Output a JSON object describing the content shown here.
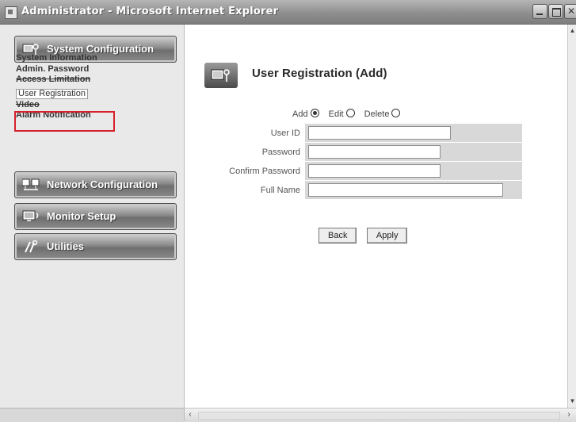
{
  "window": {
    "title": "Administrator - Microsoft Internet Explorer",
    "controls": [
      "minimize",
      "maximize",
      "close"
    ]
  },
  "sidebar": {
    "sections": [
      {
        "label": "System Configuration",
        "icon": "monitor-key-icon"
      },
      {
        "label": "Network Configuration",
        "icon": "network-computers-icon"
      },
      {
        "label": "Monitor Setup",
        "icon": "monitor-icon"
      },
      {
        "label": "Utilities",
        "icon": "tools-icon"
      }
    ],
    "submenu": [
      {
        "label": "System Information"
      },
      {
        "label": "Admin. Password"
      },
      {
        "label": "Access Limitation"
      },
      {
        "label": "User Registration",
        "current": true
      },
      {
        "label": "Video"
      },
      {
        "label": "Alarm Notification"
      }
    ]
  },
  "main": {
    "title": "User Registration (Add)",
    "modes": [
      {
        "label": "Add",
        "checked": true
      },
      {
        "label": "Edit",
        "checked": false
      },
      {
        "label": "Delete",
        "checked": false
      }
    ],
    "fields": [
      {
        "label": "User ID",
        "value": "",
        "type": "text"
      },
      {
        "label": "Password",
        "value": "",
        "type": "password"
      },
      {
        "label": "Confirm Password",
        "value": "",
        "type": "password"
      },
      {
        "label": "Full Name",
        "value": "",
        "type": "text"
      }
    ],
    "buttons": {
      "back": "Back",
      "apply": "Apply"
    }
  },
  "colors": {
    "highlight": "#d6202c"
  }
}
